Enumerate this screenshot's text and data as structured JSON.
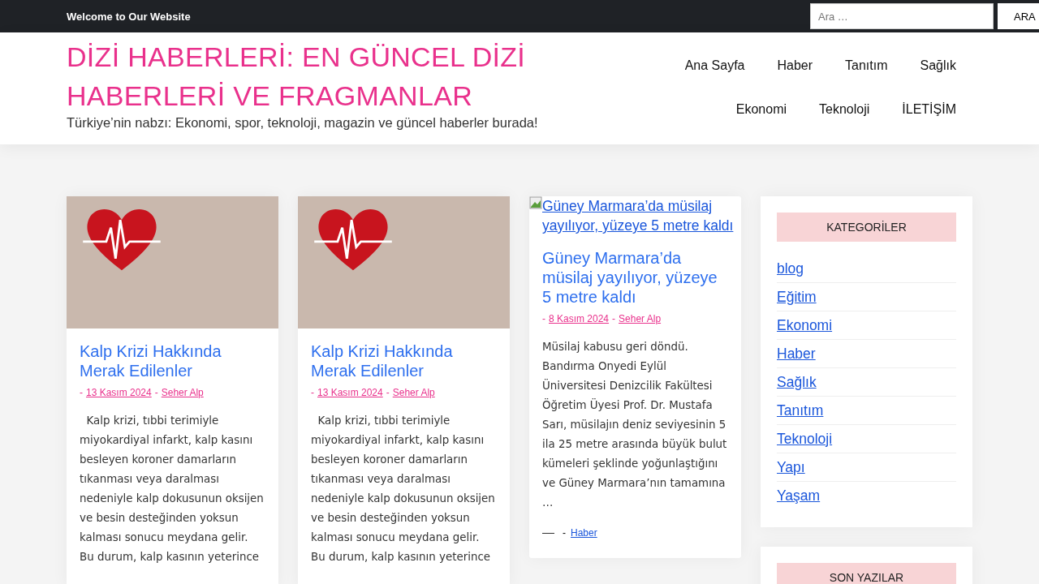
{
  "topbar": {
    "welcome": "Welcome to Our Website",
    "search": {
      "placeholder": "Ara …",
      "button": "ARA"
    }
  },
  "header": {
    "site_title": "DİZİ HABERLERİ: EN GÜNCEL DİZİ HABERLERİ VE FRAGMANLAR",
    "tagline": "Türkiye’nin nabzı: Ekonomi, spor, teknoloji, magazin ve güncel haberler burada!",
    "nav": [
      [
        "Ana Sayfa",
        "Haber",
        "Tanıtım",
        "Sağlık"
      ],
      [
        "Ekonomi",
        "Teknoloji",
        "İLETİŞİM"
      ]
    ]
  },
  "posts": [
    {
      "image": {
        "kind": "photo"
      },
      "title": "Kalp Krizi Hakkında Merak Edilenler",
      "separator": "-",
      "date": "13 Kasım 2024",
      "author": "Seher Alp",
      "excerpt": "  Kalp krizi, tıbbi terimiyle miyokardiyal infarkt, kalp kasını besleyen koroner damarların tıkanması veya daralması nedeniyle kalp dokusunun oksijen ve besin desteğinden yoksun kalması sonucu meydana gelir. Bu durum, kalp kasının yeterince"
    },
    {
      "image": {
        "kind": "photo"
      },
      "title": "Kalp Krizi Hakkında Merak Edilenler",
      "separator": "-",
      "date": "13 Kasım 2024",
      "author": "Seher Alp",
      "excerpt": "  Kalp krizi, tıbbi terimiyle miyokardiyal infarkt, kalp kasını besleyen koroner damarların tıkanması veya daralması nedeniyle kalp dokusunun oksijen ve besin desteğinden yoksun kalması sonucu meydana gelir. Bu durum, kalp kasının yeterince"
    },
    {
      "image": {
        "kind": "broken",
        "alt": "Güney Marmara’da müsilaj yayılıyor, yüzeye 5 metre kaldı"
      },
      "title": "Güney Marmara’da müsilaj yayılıyor, yüzeye 5 metre kaldı",
      "separator": "-",
      "date": "8 Kasım 2024",
      "author": "Seher Alp",
      "excerpt": "Müsilaj kabusu geri döndü. Bandırma Onyedi Eylül Üniversitesi Denizcilik Fakültesi Öğretim Üyesi Prof. Dr. Mustafa Sarı, müsilajın deniz seviyesinin 5 ila 25 metre arasında büyük bulut kümeleri şeklinde yoğunlaştığını ve Güney Marmara’nın tamamına …",
      "footer": {
        "separator": "-",
        "category": "Haber"
      }
    }
  ],
  "sidebar": [
    {
      "title": "KATEGORİLER",
      "items": [
        "blog",
        "Eğitim",
        "Ekonomi",
        "Haber",
        "Sağlık",
        "Tanıtım",
        "Teknoloji",
        "Yapı",
        "Yaşam"
      ]
    },
    {
      "title": "SON YAZILAR"
    }
  ]
}
